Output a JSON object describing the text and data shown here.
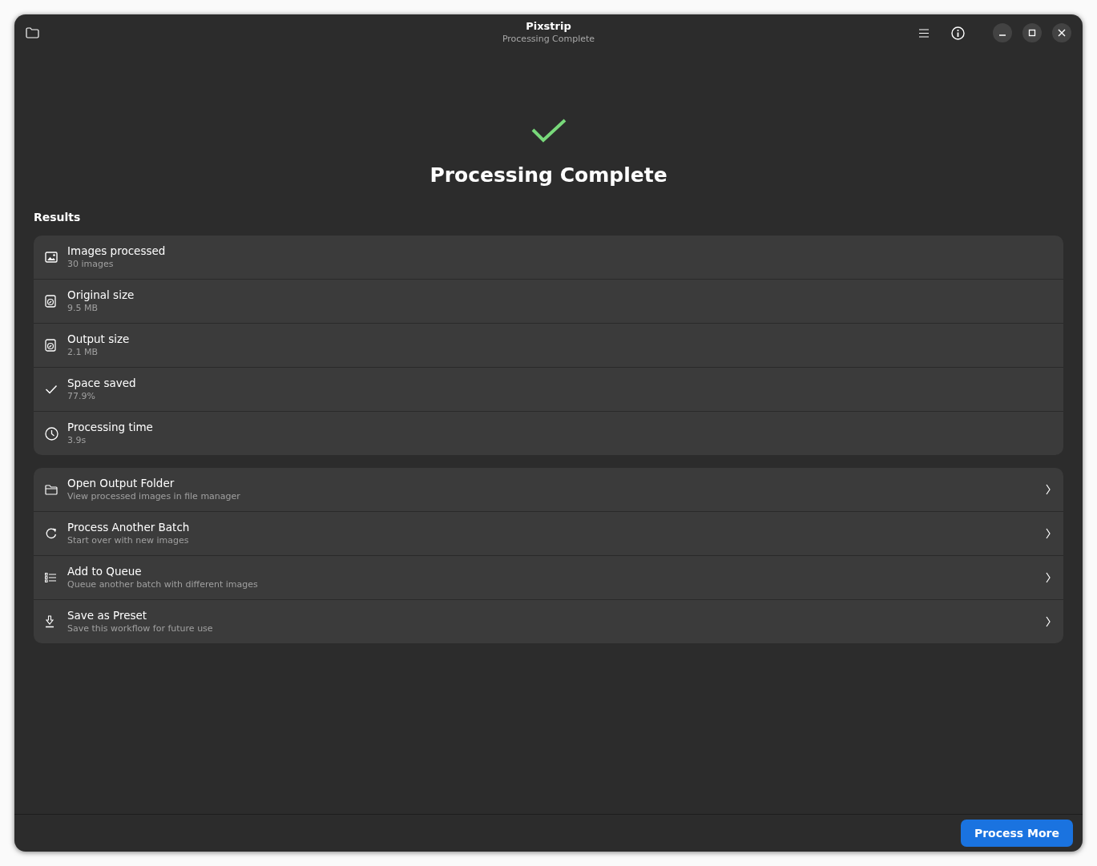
{
  "window": {
    "title": "Pixstrip",
    "subtitle": "Processing Complete"
  },
  "heading": "Processing Complete",
  "results": {
    "title": "Results",
    "rows": [
      {
        "kind": "image",
        "label": "Images processed",
        "value": "30 images"
      },
      {
        "kind": "disk",
        "label": "Original size",
        "value": "9.5 MB"
      },
      {
        "kind": "disk",
        "label": "Output size",
        "value": "2.1 MB"
      },
      {
        "kind": "check",
        "label": "Space saved",
        "value": "77.9%"
      },
      {
        "kind": "clock",
        "label": "Processing time",
        "value": "3.9s"
      }
    ]
  },
  "actions": [
    {
      "kind": "folder",
      "label": "Open Output Folder",
      "description": "View processed images in file manager"
    },
    {
      "kind": "refresh",
      "label": "Process Another Batch",
      "description": "Start over with new images"
    },
    {
      "kind": "list",
      "label": "Add to Queue",
      "description": "Queue another batch with different images"
    },
    {
      "kind": "download",
      "label": "Save as Preset",
      "description": "Save this workflow for future use"
    }
  ],
  "footer": {
    "button": "Process More"
  }
}
